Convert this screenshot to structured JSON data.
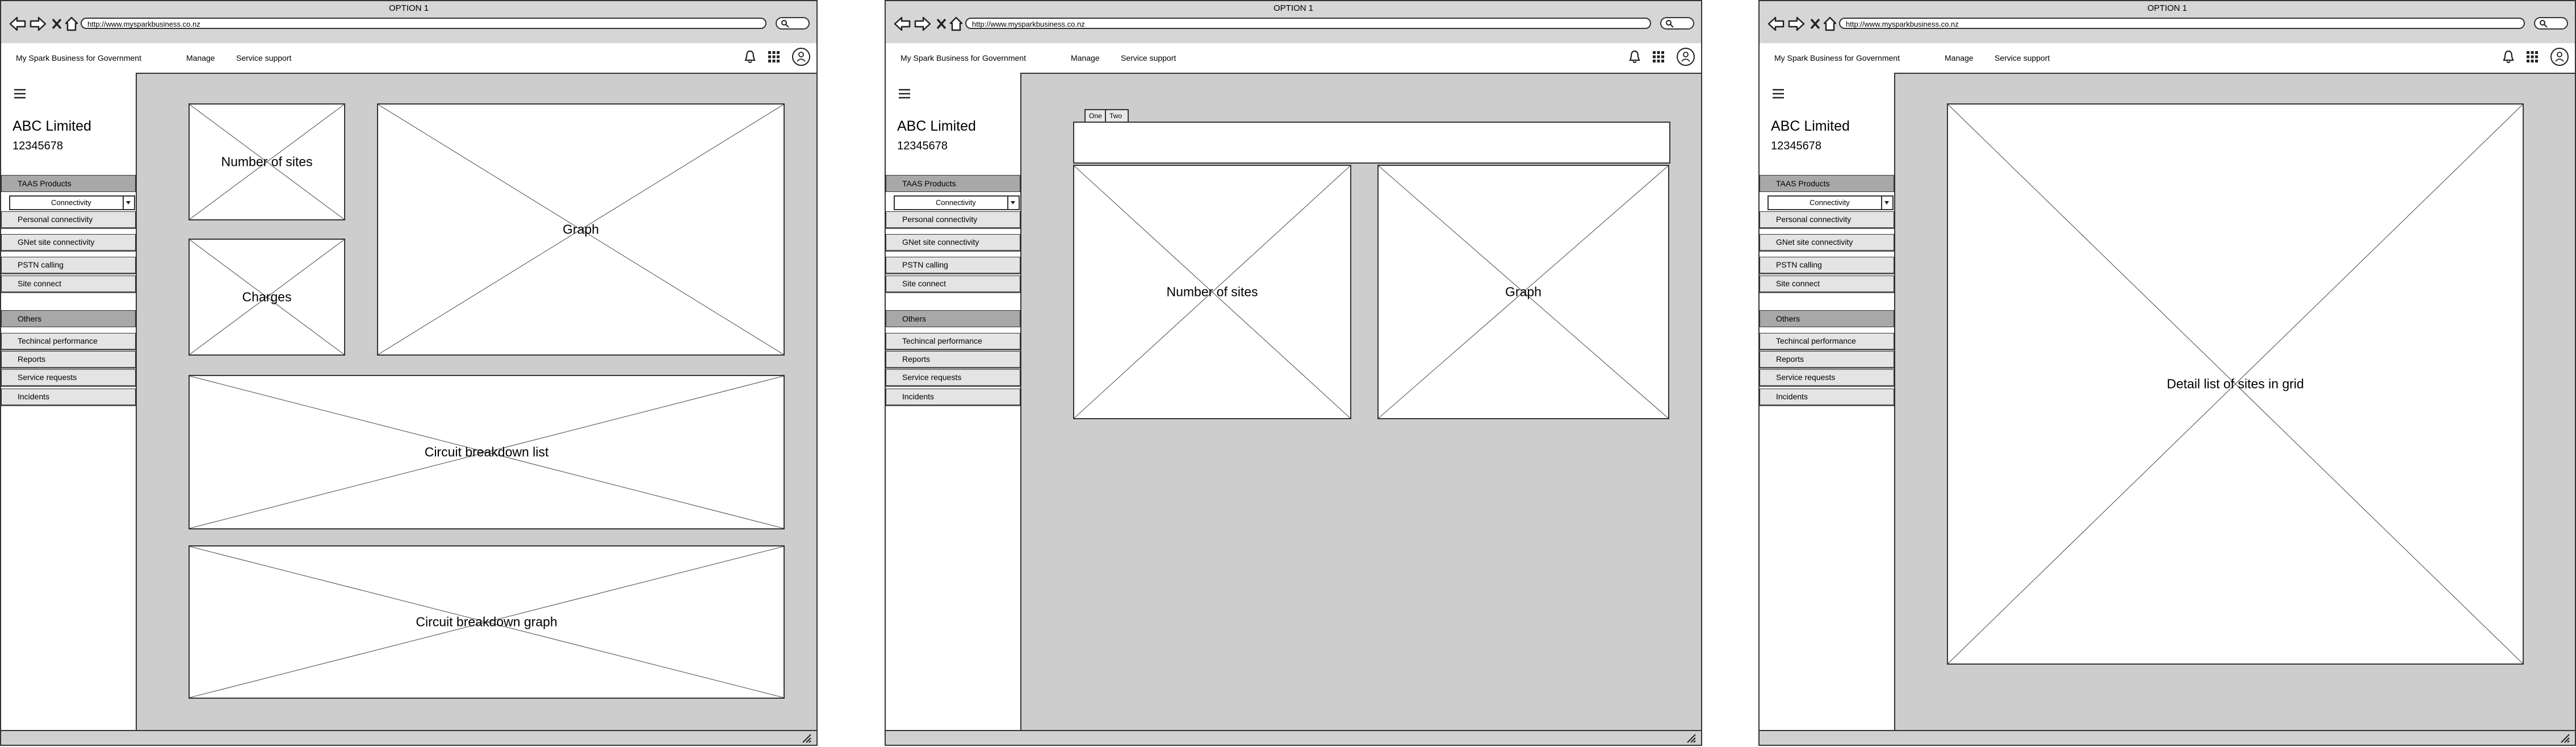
{
  "windows": [
    {
      "title": "OPTION 1",
      "url": "http://www.mysparkbusiness.co.nz",
      "header": {
        "brand": "My Spark Business for Government",
        "nav": [
          "Manage",
          "Service support"
        ]
      },
      "sidebar": {
        "company": "ABC Limited",
        "account": "12345678",
        "products_heading": "TAAS Products",
        "dropdown_value": "Connectivity",
        "product_items": [
          "Personal connectivity",
          "GNet site connectivity",
          "PSTN calling",
          "Site connect"
        ],
        "others_heading": "Others",
        "other_items": [
          "Techincal performance",
          "Reports",
          "Service requests",
          "Incidents"
        ]
      },
      "content": {
        "placeholders": [
          "Number of sites",
          "Charges",
          "Graph",
          "Circuit breakdown list",
          "Circuit breakdown graph"
        ]
      }
    },
    {
      "title": "OPTION 1",
      "url": "http://www.mysparkbusiness.co.nz",
      "header": {
        "brand": "My Spark Business for Government",
        "nav": [
          "Manage",
          "Service support"
        ]
      },
      "sidebar": {
        "company": "ABC Limited",
        "account": "12345678",
        "products_heading": "TAAS Products",
        "dropdown_value": "Connectivity",
        "product_items": [
          "Personal connectivity",
          "GNet site connectivity",
          "PSTN calling",
          "Site connect"
        ],
        "others_heading": "Others",
        "other_items": [
          "Techincal performance",
          "Reports",
          "Service requests",
          "Incidents"
        ]
      },
      "content": {
        "tabs": [
          "One",
          "Two"
        ],
        "placeholders": [
          "Number of sites",
          "Graph"
        ]
      }
    },
    {
      "title": "OPTION 1",
      "url": "http://www.mysparkbusiness.co.nz",
      "header": {
        "brand": "My Spark Business for Government",
        "nav": [
          "Manage",
          "Service support"
        ]
      },
      "sidebar": {
        "company": "ABC Limited",
        "account": "12345678",
        "products_heading": "TAAS Products",
        "dropdown_value": "Connectivity",
        "product_items": [
          "Personal connectivity",
          "GNet site connectivity",
          "PSTN calling",
          "Site connect"
        ],
        "others_heading": "Others",
        "other_items": [
          "Techincal performance",
          "Reports",
          "Service requests",
          "Incidents"
        ]
      },
      "content": {
        "placeholders": [
          "Detail list of sites in grid"
        ]
      }
    }
  ],
  "icons": [
    "back-arrow-icon",
    "forward-arrow-icon",
    "close-icon",
    "home-icon",
    "search-icon",
    "bell-icon",
    "grid-icon",
    "user-icon",
    "menu-icon",
    "resize-grip-icon"
  ]
}
